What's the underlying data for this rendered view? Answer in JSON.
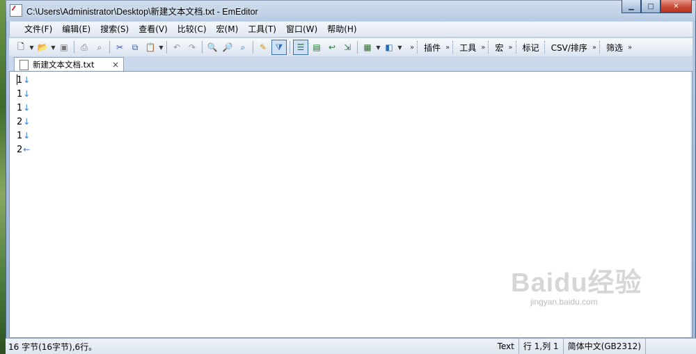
{
  "window": {
    "title": "C:\\Users\\Administrator\\Desktop\\新建文本文档.txt - EmEditor",
    "controls": [
      "minimize-icon",
      "maximize-icon",
      "close-icon"
    ]
  },
  "menu": {
    "items": [
      {
        "label": "文件(F)"
      },
      {
        "label": "编辑(E)"
      },
      {
        "label": "搜索(S)"
      },
      {
        "label": "查看(V)"
      },
      {
        "label": "比较(C)"
      },
      {
        "label": "宏(M)"
      },
      {
        "label": "工具(T)"
      },
      {
        "label": "窗口(W)"
      },
      {
        "label": "帮助(H)"
      }
    ]
  },
  "toolbar": {
    "labels": {
      "plugins": "插件",
      "tools": "工具",
      "macros": "宏",
      "marker": "标记",
      "csv": "CSV/排序",
      "filter": "筛选"
    }
  },
  "tab": {
    "label": "新建文本文档.txt",
    "close": "×"
  },
  "editor": {
    "lines": [
      {
        "text": "1",
        "mark": "↓"
      },
      {
        "text": "1",
        "mark": "↓"
      },
      {
        "text": "1",
        "mark": "↓"
      },
      {
        "text": "2",
        "mark": "↓"
      },
      {
        "text": "1",
        "mark": "↓"
      },
      {
        "text": "2",
        "mark": "←"
      }
    ]
  },
  "status": {
    "info": "16 字节(16字节),6行。",
    "mode": "Text",
    "position": "行 1,列 1",
    "encoding": "简体中文(GB2312)"
  },
  "watermark": {
    "big": "Baidu经验",
    "small": "jingyan.baidu.com"
  }
}
